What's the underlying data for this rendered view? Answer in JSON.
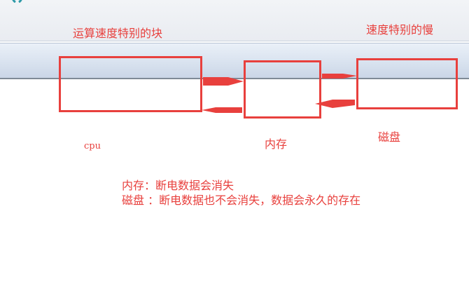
{
  "labels": {
    "fast": "运算速度特别的块",
    "slow": "速度特别的慢",
    "cpu": "cpu",
    "memory": "内存",
    "disk": "磁盘"
  },
  "notes": [
    "内存：断电数据会消失",
    "磁盘 ：断电数据也不会消失，数据会永久的存在"
  ],
  "colors": {
    "accent": "#e8403d"
  }
}
